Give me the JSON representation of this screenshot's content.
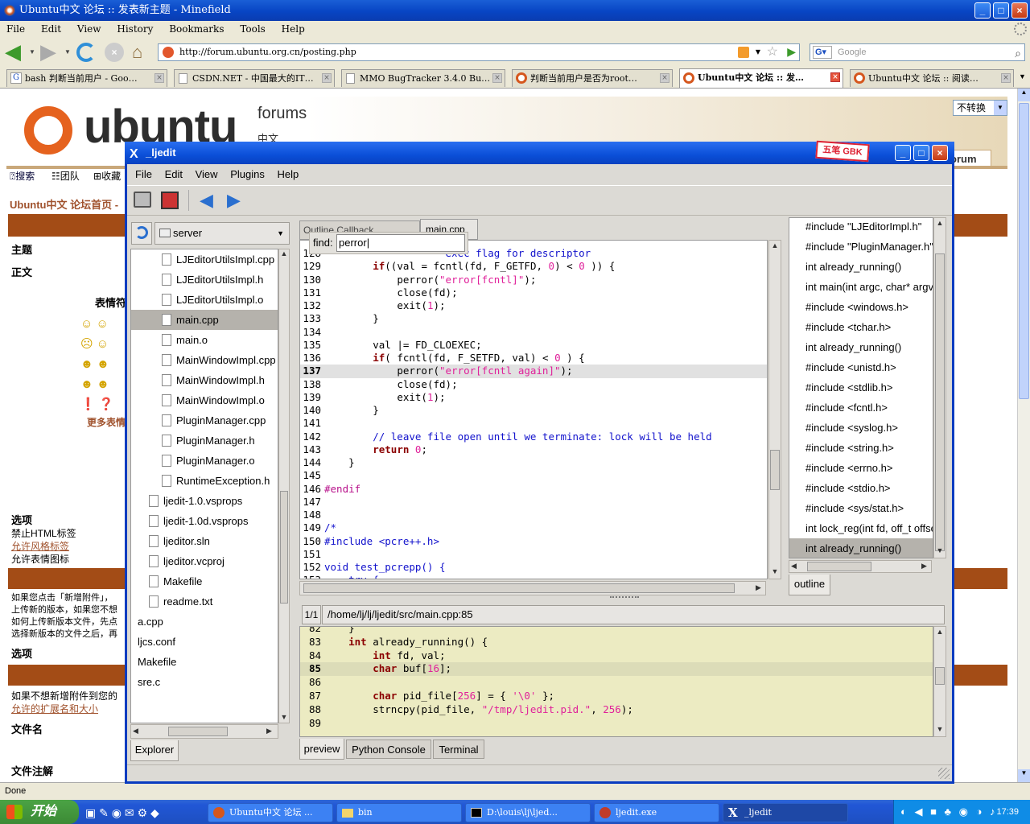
{
  "firefox": {
    "title": "Ubuntu中文 论坛 :: 发表新主题 - Minefield",
    "menu": [
      "File",
      "Edit",
      "View",
      "History",
      "Bookmarks",
      "Tools",
      "Help"
    ],
    "url": "http://forum.ubuntu.org.cn/posting.php",
    "search_placeholder": "Google",
    "tabs": [
      {
        "label": "bash 判断当前用户 - Goo…",
        "active": false
      },
      {
        "label": "CSDN.NET - 中国最大的IT…",
        "active": false
      },
      {
        "label": "MMO BugTracker 3.4.0 Bu…",
        "active": false
      },
      {
        "label": "判断当前用户是否为root…",
        "active": false
      },
      {
        "label": "Ubuntu中文 论坛 :: 发…",
        "active": true
      },
      {
        "label": "Ubuntu中文 论坛 :: 阅读…",
        "active": false
      }
    ],
    "status": "Done"
  },
  "page": {
    "logo_text": "ubuntu",
    "forums_label": "forums",
    "cn_label": "中文",
    "encoding_select": "不转换",
    "tab_forum": "orum",
    "links": [
      "搜索",
      "团队",
      "收藏"
    ],
    "breadcrumb": "Ubuntu中文 论坛首页 -",
    "labels": {
      "subject": "主题",
      "body": "正文",
      "emoticons": "表情符",
      "more": "更多表情",
      "options": "选项",
      "opt1": "禁止HTML标签",
      "opt2": "允许风格标签",
      "opt3": "允许表情图标",
      "options2": "选项",
      "filename": "文件名",
      "filecomment": "文件注解"
    },
    "attach_text": [
      "如果您点击「新增附件」，",
      "上传新的版本，如果您不想",
      "如何上传新版本文件，先点",
      "选择新版本的文件之后，再"
    ],
    "attach_text2": "如果不想新增附件到您的",
    "attach_link": "允许的扩展名和大小"
  },
  "ljedit": {
    "title": "_ljedit",
    "badge": "五笔 GBK",
    "menu": [
      "File",
      "Edit",
      "View",
      "Plugins",
      "Help"
    ],
    "explorer": {
      "folder": "server",
      "items": [
        {
          "name": "LJEditorUtilsImpl.cpp",
          "indent": 2,
          "selected": false
        },
        {
          "name": "LJEditorUtilsImpl.h",
          "indent": 2,
          "selected": false
        },
        {
          "name": "LJEditorUtilsImpl.o",
          "indent": 2,
          "selected": false
        },
        {
          "name": "main.cpp",
          "indent": 2,
          "selected": true
        },
        {
          "name": "main.o",
          "indent": 2,
          "selected": false
        },
        {
          "name": "MainWindowImpl.cpp",
          "indent": 2,
          "selected": false
        },
        {
          "name": "MainWindowImpl.h",
          "indent": 2,
          "selected": false
        },
        {
          "name": "MainWindowImpl.o",
          "indent": 2,
          "selected": false
        },
        {
          "name": "PluginManager.cpp",
          "indent": 2,
          "selected": false
        },
        {
          "name": "PluginManager.h",
          "indent": 2,
          "selected": false
        },
        {
          "name": "PluginManager.o",
          "indent": 2,
          "selected": false
        },
        {
          "name": "RuntimeException.h",
          "indent": 2,
          "selected": false
        },
        {
          "name": "ljedit-1.0.vsprops",
          "indent": 1,
          "selected": false
        },
        {
          "name": "ljedit-1.0d.vsprops",
          "indent": 1,
          "selected": false
        },
        {
          "name": "ljeditor.sln",
          "indent": 1,
          "selected": false
        },
        {
          "name": "ljeditor.vcproj",
          "indent": 1,
          "selected": false
        },
        {
          "name": "Makefile",
          "indent": 1,
          "selected": false
        },
        {
          "name": "readme.txt",
          "indent": 1,
          "selected": false
        },
        {
          "name": "a.cpp",
          "indent": 0,
          "selected": false
        },
        {
          "name": "ljcs.conf",
          "indent": 0,
          "selected": false
        },
        {
          "name": "Makefile",
          "indent": 0,
          "selected": false
        },
        {
          "name": "sre.c",
          "indent": 0,
          "selected": false
        }
      ],
      "tab": "Explorer"
    },
    "editor_tabs": [
      "Outline Callback",
      "main.cpp"
    ],
    "find_label": "find:",
    "find_value": "perror",
    "code": [
      {
        "n": "128",
        "t": "                   -exec flag for descriptor",
        "cls": "cmt"
      },
      {
        "n": "129",
        "t": "        if((val = fcntl(fd, F_GETFD, 0) < 0 )) {",
        "cls": ""
      },
      {
        "n": "130",
        "t": "            perror(\"error[fcntl]\");",
        "cls": ""
      },
      {
        "n": "131",
        "t": "            close(fd);",
        "cls": ""
      },
      {
        "n": "132",
        "t": "            exit(1);",
        "cls": ""
      },
      {
        "n": "133",
        "t": "        }",
        "cls": ""
      },
      {
        "n": "134",
        "t": "",
        "cls": ""
      },
      {
        "n": "135",
        "t": "        val |= FD_CLOEXEC;",
        "cls": ""
      },
      {
        "n": "136",
        "t": "        if( fcntl(fd, F_SETFD, val) < 0 ) {",
        "cls": ""
      },
      {
        "n": "137",
        "t": "            perror(\"error[fcntl again]\");",
        "cls": "hl"
      },
      {
        "n": "138",
        "t": "            close(fd);",
        "cls": ""
      },
      {
        "n": "139",
        "t": "            exit(1);",
        "cls": ""
      },
      {
        "n": "140",
        "t": "        }",
        "cls": ""
      },
      {
        "n": "141",
        "t": "",
        "cls": ""
      },
      {
        "n": "142",
        "t": "        // leave file open until we terminate: lock will be held",
        "cls": "cmt"
      },
      {
        "n": "143",
        "t": "        return 0;",
        "cls": ""
      },
      {
        "n": "144",
        "t": "    }",
        "cls": ""
      },
      {
        "n": "145",
        "t": "",
        "cls": ""
      },
      {
        "n": "146",
        "t": "#endif",
        "cls": "pp"
      },
      {
        "n": "147",
        "t": "",
        "cls": ""
      },
      {
        "n": "148",
        "t": "",
        "cls": ""
      },
      {
        "n": "149",
        "t": "/*",
        "cls": "cmt"
      },
      {
        "n": "150",
        "t": "#include <pcre++.h>",
        "cls": "cmt"
      },
      {
        "n": "151",
        "t": "",
        "cls": ""
      },
      {
        "n": "152",
        "t": "void test_pcrepp() {",
        "cls": "cmt"
      },
      {
        "n": "153",
        "t": "    try {",
        "cls": "cmt"
      }
    ],
    "outline": [
      "#include \"LJEditorImpl.h\"",
      "#include \"PluginManager.h\"",
      "int already_running()",
      "int main(int argc, char* argv[])",
      "#include <windows.h>",
      "#include <tchar.h>",
      "int already_running()",
      "#include <unistd.h>",
      "#include <stdlib.h>",
      "#include <fcntl.h>",
      "#include <syslog.h>",
      "#include <string.h>",
      "#include <errno.h>",
      "#include <stdio.h>",
      "#include <sys/stat.h>",
      "int lock_reg(int fd, off_t offset)",
      "int already_running()"
    ],
    "outline_tab": "outline",
    "preview": {
      "counter": "1/1",
      "path": "/home/lj/lj/ljedit/src/main.cpp:85",
      "lines": [
        {
          "n": "82",
          "t": "    }"
        },
        {
          "n": "83",
          "t": "    int already_running() {"
        },
        {
          "n": "84",
          "t": "        int fd, val;"
        },
        {
          "n": "85",
          "t": "        char buf[16];"
        },
        {
          "n": "86",
          "t": ""
        },
        {
          "n": "87",
          "t": "        char pid_file[256] = { '\\0' };"
        },
        {
          "n": "88",
          "t": "        strncpy(pid_file, \"/tmp/ljedit.pid.\", 256);"
        },
        {
          "n": "89",
          "t": ""
        }
      ]
    },
    "bottom_tabs": [
      "preview",
      "Python Console",
      "Terminal"
    ]
  },
  "taskbar": {
    "start": "开始",
    "tasks": [
      "Ubuntu中文 论坛 ...",
      "bin",
      "D:\\louis\\lj\\ljed...",
      "ljedit.exe",
      "_ljedit"
    ],
    "clock": "17:39"
  }
}
